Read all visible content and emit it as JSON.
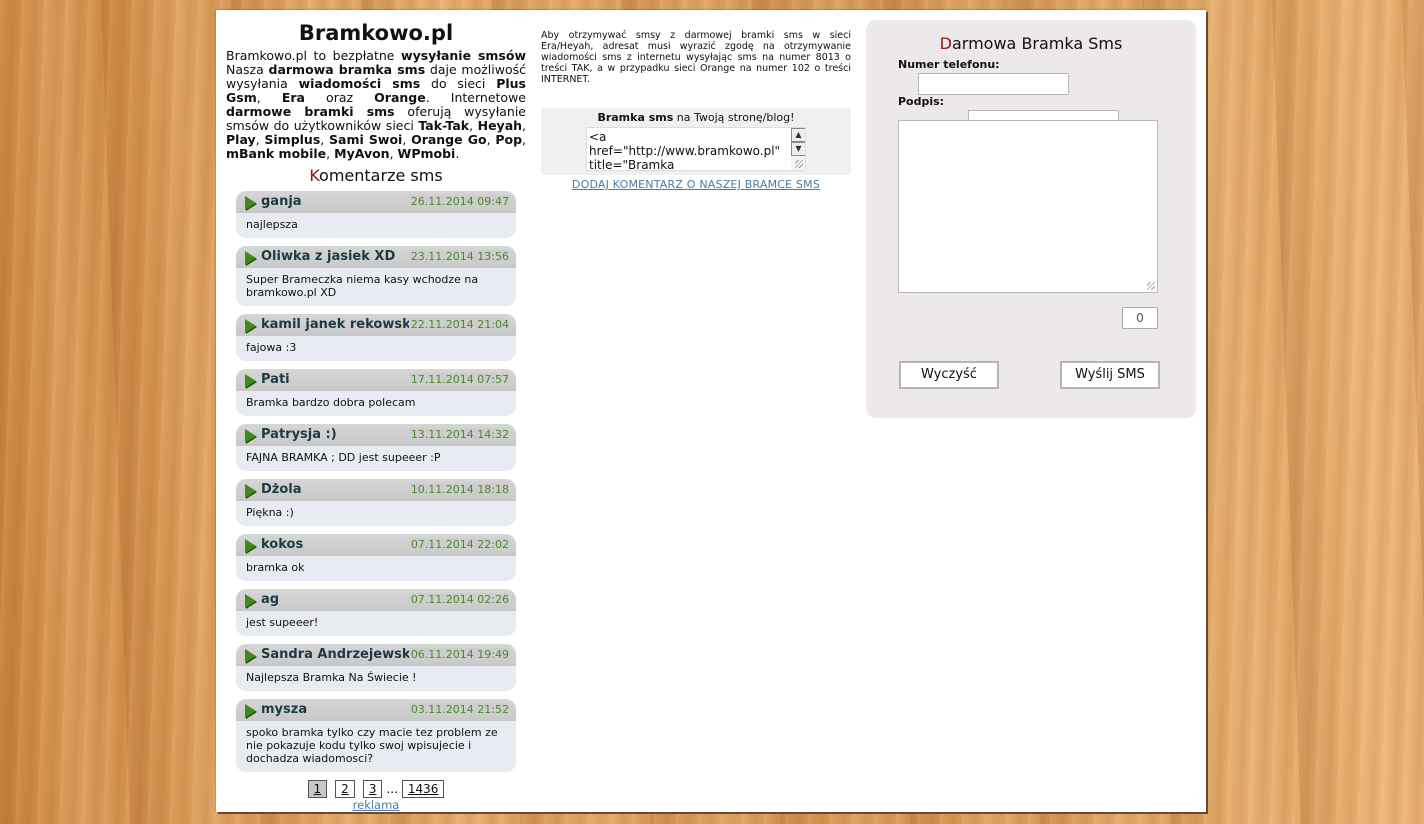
{
  "site": {
    "title": "Bramkowo.pl"
  },
  "intro": {
    "p1": "Bramkowo.pl to bezpłatne ",
    "b1": "wysyłanie smsów",
    "p2": " Nasza ",
    "b2": "darmowa bramka sms",
    "p3": " daje możliwość wysyłania ",
    "b3": "wiadomości sms",
    "p4": " do sieci ",
    "b4": "Plus Gsm",
    "p5": ", ",
    "b5": "Era",
    "p6": " oraz ",
    "b6": "Orange",
    "p7": ". Internetowe ",
    "b7": "darmowe bramki sms",
    "p8": " oferują wysyłanie smsów do użytkowników sieci ",
    "b8": "Tak-Tak",
    "p9": ", ",
    "b9": "Heyah",
    "p10": ", ",
    "b10": "Play",
    "p11": ", ",
    "b11": "Simplus",
    "p12": ", ",
    "b12": "Sami Swoi",
    "p13": ", ",
    "b13": "Orange Go",
    "p14": ", ",
    "b14": "Pop",
    "p15": ", ",
    "b15": "mBank mobile",
    "p16": ", ",
    "b16": "MyAvon",
    "p17": ", ",
    "b17": "WPmobi",
    "p18": "."
  },
  "comments_section": {
    "title_first": "K",
    "title_rest": "omentarze sms"
  },
  "comments": [
    {
      "name": "ganja",
      "date": "26.11.2014 09:47",
      "text": "najlepsza"
    },
    {
      "name": "Oliwka z jasiek XD",
      "date": "23.11.2014 13:56",
      "text": "Super Brameczka niema kasy wchodze na bramkowo.pl XD"
    },
    {
      "name": "kamil janek rekowski",
      "date": "22.11.2014 21:04",
      "text": "fajowa :3"
    },
    {
      "name": "Pati",
      "date": "17.11.2014 07:57",
      "text": "Bramka bardzo dobra polecam"
    },
    {
      "name": "Patrysja :)",
      "date": "13.11.2014 14:32",
      "text": "FAJNA BRAMKA ; DD jest supeeer :P"
    },
    {
      "name": "Dżola",
      "date": "10.11.2014 18:18",
      "text": "Piękna :)"
    },
    {
      "name": "kokos",
      "date": "07.11.2014 22:02",
      "text": "bramka ok"
    },
    {
      "name": "ag",
      "date": "07.11.2014 02:26",
      "text": "jest supeeer!"
    },
    {
      "name": "Sandra Andrzejewska",
      "date": "06.11.2014 19:49",
      "text": "Najlepsza Bramka Na Świecie !"
    },
    {
      "name": "mysza",
      "date": "03.11.2014 21:52",
      "text": "spoko bramka tylko czy macie tez problem ze nie pokazuje kodu tylko swoj wpisujecie i dochadza wiadomosci?"
    }
  ],
  "pagination": {
    "pages": [
      "1",
      "2",
      "3"
    ],
    "ellipsis": "...",
    "last": "1436",
    "active": "1"
  },
  "reklama": "reklama",
  "info_text": "Aby otrzymywać smsy z darmowej bramki sms w sieci Era/Heyah, adresat musi wyrazić zgodę na otrzymywanie wiadomości sms z internetu wysyłając sms na numer 8013 o treści TAK, a w przypadku sieci Orange na numer 102 o treści INTERNET.",
  "embed": {
    "title_bold": "Bramka sms",
    "title_rest": " na Twoją stronę/blog!",
    "code": "<a\nhref=\"http://www.bramkowo.pl\"\ntitle=\"Bramka"
  },
  "add_comment_link": "DODAJ KOMENTARZ O NASZEJ BRAMCE SMS",
  "form": {
    "title_first": "D",
    "title_rest": "armowa Bramka Sms",
    "phone_label": "Numer telefonu:",
    "signature_label": "Podpis:",
    "phone_value": "",
    "signature_value": "",
    "message_value": "",
    "counter": "0",
    "clear_button": "Wyczyść",
    "send_button": "Wyślij SMS"
  }
}
